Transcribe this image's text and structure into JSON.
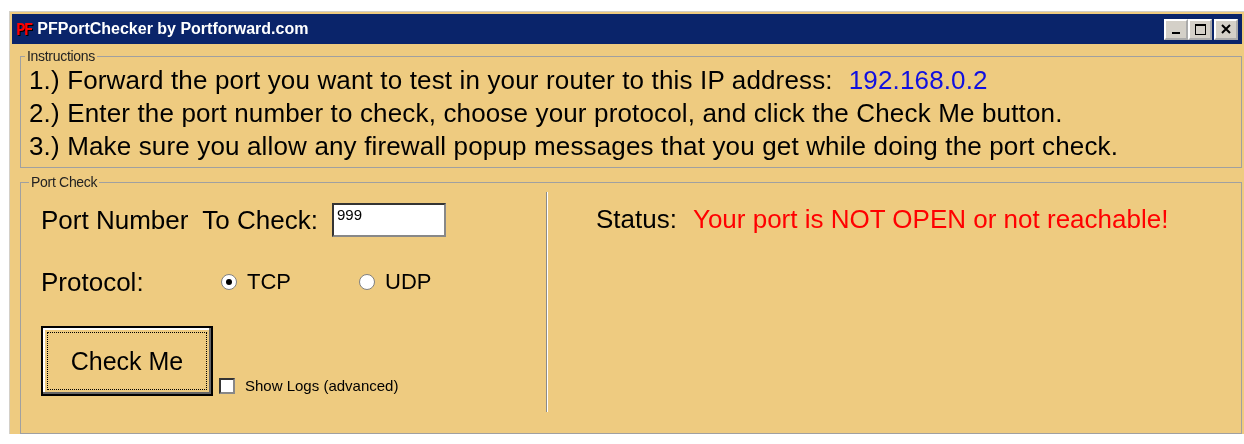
{
  "window": {
    "logo": "PF",
    "title": "PFPortChecker by Portforward.com"
  },
  "instructions": {
    "legend": "Instructions",
    "lines": [
      {
        "text": "1.) Forward the port you want to test in your router to this IP address:",
        "address": "192.168.0.2"
      },
      {
        "text": "2.) Enter the port number to check, choose your protocol, and click the Check Me button."
      },
      {
        "text": "3.) Make sure you allow any firewall popup messages that you get while doing the port check."
      }
    ]
  },
  "port_check": {
    "legend": "Port Check",
    "port_label": "Port Number  To Check:",
    "port_value": "999",
    "protocol_label": "Protocol:",
    "protocols": [
      {
        "label": "TCP",
        "selected": true
      },
      {
        "label": "UDP",
        "selected": false
      }
    ],
    "check_button": "Check Me",
    "show_logs": {
      "label": "Show Logs (advanced)",
      "checked": false
    },
    "status_label": "Status:",
    "status_text": "Your port is NOT OPEN or not reachable!"
  }
}
